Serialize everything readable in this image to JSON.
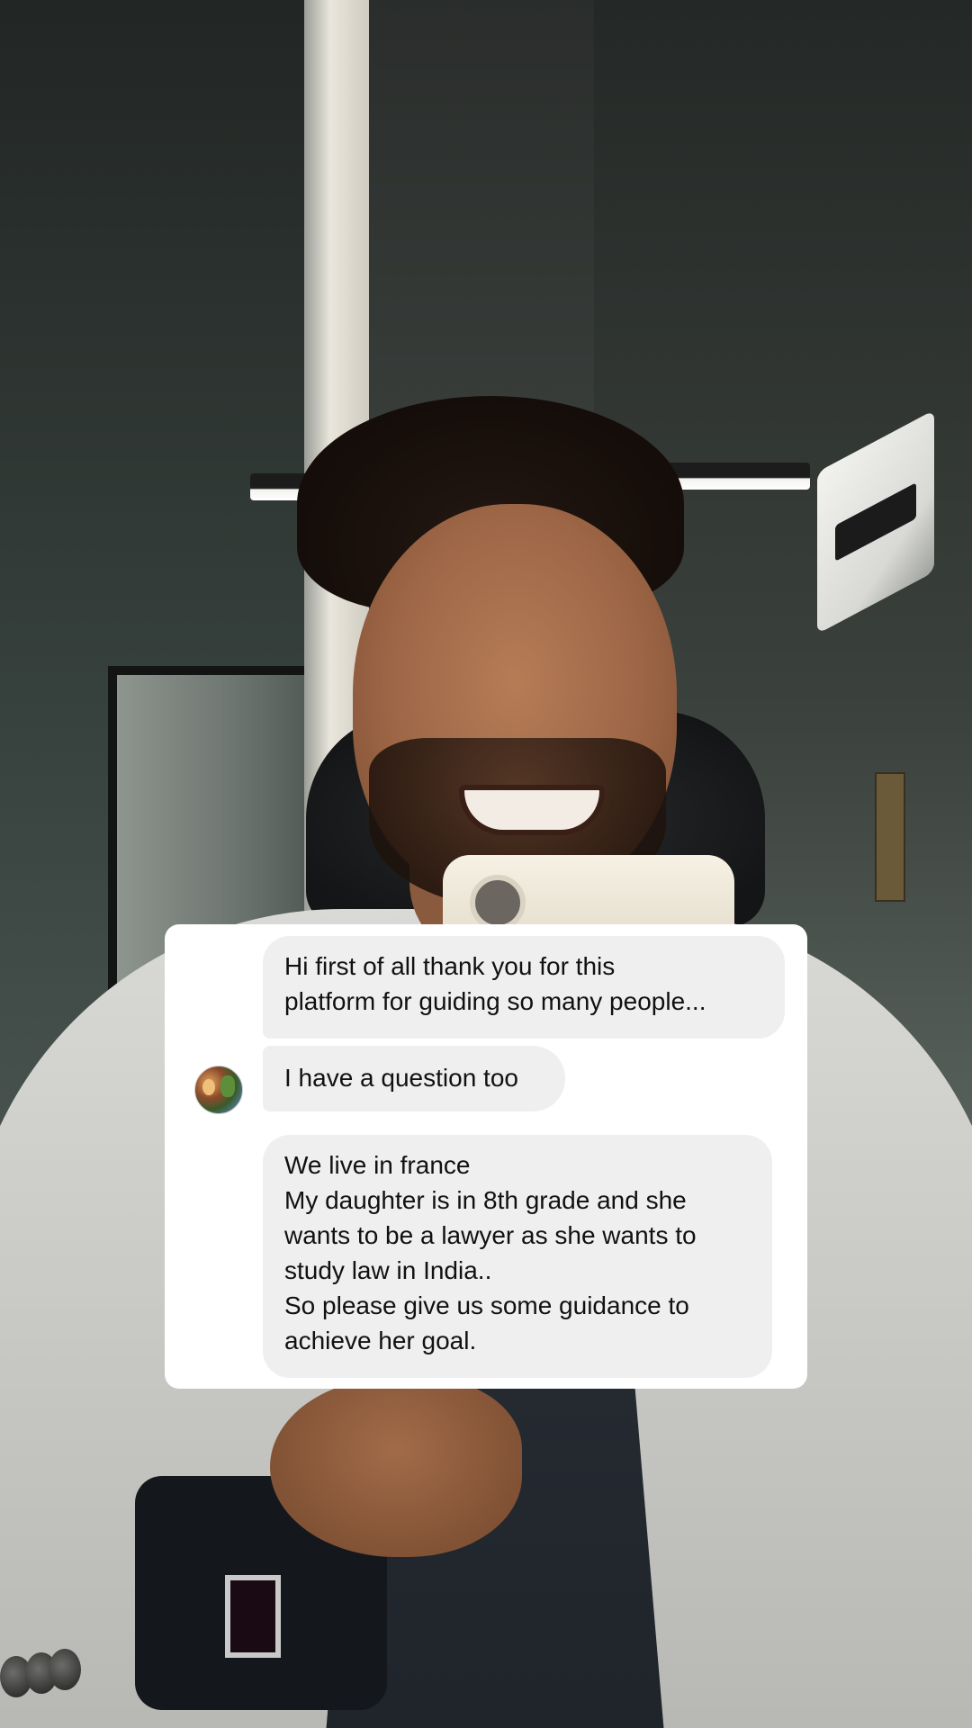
{
  "conversation": {
    "messages": [
      {
        "text": "Hi first of all thank you for this\nplatform for guiding so many people..."
      },
      {
        "text": "I have a question too"
      },
      {
        "text": "We live in france\nMy daughter is in 8th grade and she\nwants to be a lawyer as she wants to\nstudy law in India..\nSo please give us some guidance to\nachieve her goal."
      }
    ]
  },
  "colors": {
    "bubble_background": "#efefef",
    "card_background": "#ffffff",
    "text": "#111111"
  },
  "icons": {
    "sender_avatar": "profile-photo-avatar"
  }
}
